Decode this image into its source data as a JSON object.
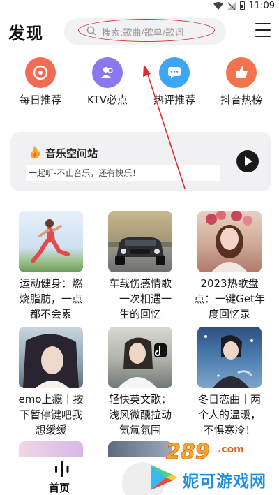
{
  "status_bar": {
    "time": "11:09"
  },
  "header": {
    "title": "发现",
    "search_placeholder": "搜索:歌曲/歌单/歌词"
  },
  "quick_entries": [
    {
      "label": "每日推荐",
      "icon": "vinyl-disc-icon",
      "color": "#f36b52"
    },
    {
      "label": "KTV必点",
      "icon": "users-icon",
      "color": "#8a78ef"
    },
    {
      "label": "热评推荐",
      "icon": "chat-bubble-icon",
      "color": "#3ea7f5"
    },
    {
      "label": "抖音热榜",
      "icon": "thumb-up-icon",
      "color": "#f2744c"
    }
  ],
  "station": {
    "title": "音乐空间站",
    "subtitle": "一起听-不止音乐，还有快乐！"
  },
  "playlists": [
    {
      "title": "运动健身：燃烧脂肪，一点都不会累",
      "lines": [
        "运动健身：燃",
        "烧脂肪，一点",
        "都不会累"
      ]
    },
    {
      "title": "车载伤感情歌｜一次相遇一生的回忆",
      "lines": [
        "车载伤感情歌",
        "｜一次相遇一",
        "生的回忆"
      ]
    },
    {
      "title": "2023热歌盘点：一键Get年度回忆录",
      "lines": [
        "2023热歌盘",
        "点：一键Get年",
        "度回忆录"
      ]
    },
    {
      "title": "emo上瘾｜按下暂停键吧我想缓缓",
      "lines": [
        "emo上瘾｜按",
        "下暂停键吧我",
        "想缓缓"
      ]
    },
    {
      "title": "轻快英文歌：浅风微醺拉动氤氲氛围",
      "lines": [
        "轻快英文歌：",
        "浅风微醺拉动",
        "氤氲氛围"
      ]
    },
    {
      "title": "冬日恋曲｜两个人的温暖，不惧寒冷！",
      "lines": [
        "冬日恋曲｜两",
        "个人的温暖，",
        "不惧寒冷！"
      ]
    }
  ],
  "bottom_nav": {
    "home_label": "首页"
  },
  "watermark": {
    "number": "289",
    "domain": ".com",
    "name": "妮可游戏网"
  }
}
